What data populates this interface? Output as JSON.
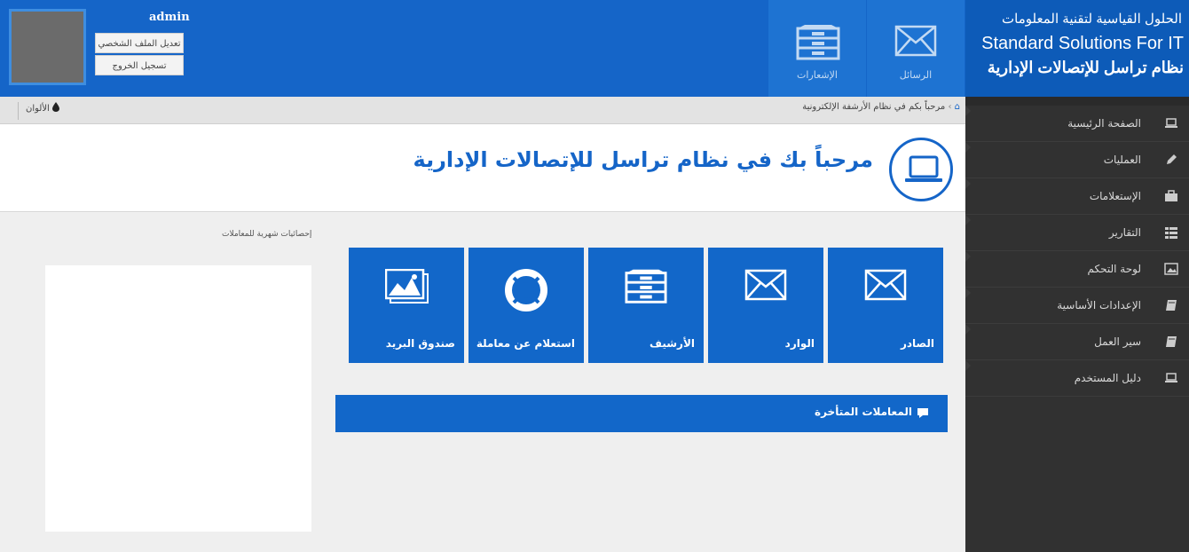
{
  "header": {
    "user_name": "admin",
    "edit_profile": "تعديل الملف الشخصي",
    "logout": "تسجيل الخروج",
    "notifications_label": "الإشعارات",
    "messages_label": "الرسائل"
  },
  "brand": {
    "line1": "الحلول القياسية لتقنية المعلومات",
    "line2": "Standard Solutions For IT",
    "line3": "نظام تراسل للإتصالات الإدارية"
  },
  "sidebar": {
    "items": [
      {
        "label": "الصفحة الرئيسية",
        "icon": "laptop-icon"
      },
      {
        "label": "العمليات",
        "icon": "pencil-icon"
      },
      {
        "label": "الإستعلامات",
        "icon": "briefcase-icon"
      },
      {
        "label": "التقارير",
        "icon": "list-icon"
      },
      {
        "label": "لوحة التحكم",
        "icon": "picture-icon"
      },
      {
        "label": "الإعدادات الأساسية",
        "icon": "book-icon"
      },
      {
        "label": "سير العمل",
        "icon": "book-icon"
      },
      {
        "label": "دليل المستخدم",
        "icon": "laptop-icon"
      }
    ]
  },
  "breadcrumb": {
    "text": "مرحباً بكم في نظام الأرشفة الإلكترونية",
    "colors_label": "الألوان"
  },
  "welcome": {
    "title": "مرحباً بك في نظام تراسل للإتصالات الإدارية"
  },
  "stats": {
    "label": "إحصائيات شهرية للمعاملات"
  },
  "tiles": {
    "outgoing": "الصادر",
    "incoming": "الوارد",
    "archive": "الأرشيف",
    "inquiry": "استعلام عن معاملة",
    "mailbox": "صندوق البريد"
  },
  "late": {
    "label": "المعاملات المتأخرة"
  },
  "colors": {
    "primary": "#1565c8",
    "sidebar": "#313131",
    "brand": "#0d5bb8"
  }
}
